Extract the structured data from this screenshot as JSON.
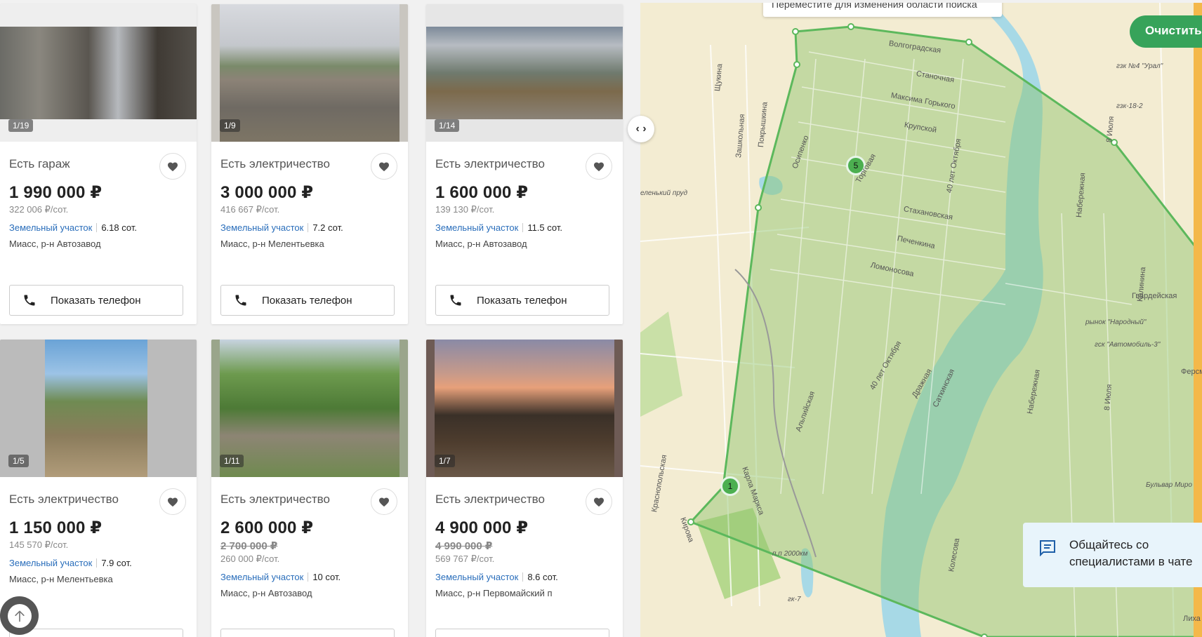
{
  "listings": [
    {
      "feature": "Есть гараж",
      "price": "1 990 000 ₽",
      "old_price": "",
      "per_sot": "322 006 ₽/сот.",
      "type": "Земельный участок",
      "area": "6.18 сот.",
      "address": "Миасс, р-н Автозавод",
      "photo_counter": "1/19",
      "phone_label": "Показать телефон"
    },
    {
      "feature": "Есть электричество",
      "price": "3 000 000 ₽",
      "old_price": "",
      "per_sot": "416 667 ₽/сот.",
      "type": "Земельный участок",
      "area": "7.2 сот.",
      "address": "Миасс, р-н Мелентьевка",
      "photo_counter": "1/9",
      "phone_label": "Показать телефон"
    },
    {
      "feature": "Есть электричество",
      "price": "1 600 000 ₽",
      "old_price": "",
      "per_sot": "139 130 ₽/сот.",
      "type": "Земельный участок",
      "area": "11.5 сот.",
      "address": "Миасс, р-н Автозавод",
      "photo_counter": "1/14",
      "phone_label": "Показать телефон"
    },
    {
      "feature": "Есть электричество",
      "price": "1 150 000 ₽",
      "old_price": "",
      "per_sot": "145 570 ₽/сот.",
      "type": "Земельный участок",
      "area": "7.9 сот.",
      "address": "Миасс, р-н Мелентьевка",
      "photo_counter": "1/5",
      "phone_label": ""
    },
    {
      "feature": "Есть электричество",
      "price": "2 600 000 ₽",
      "old_price": "2 700 000 ₽",
      "per_sot": "260 000 ₽/сот.",
      "type": "Земельный участок",
      "area": "10 сот.",
      "address": "Миасс, р-н Автозавод",
      "photo_counter": "1/11",
      "phone_label": ""
    },
    {
      "feature": "Есть электричество",
      "price": "4 900 000 ₽",
      "old_price": "4 990 000 ₽",
      "per_sot": "569 767 ₽/сот.",
      "type": "Земельный участок",
      "area": "8.6 сот.",
      "address": "Миасс, р-н Первомайский п",
      "photo_counter": "1/7",
      "phone_label": ""
    }
  ],
  "collapse_toggle": "‹ ›",
  "map": {
    "tooltip": "Переместите для изменения области поиска",
    "clear_button": "Очистить об",
    "chat_text": "Общайтесь со специалистами в чате",
    "clusters": [
      "5",
      "1"
    ],
    "streets": [
      "Волгоградская",
      "Станочная",
      "Максима Горького",
      "Крупской",
      "Торговая",
      "40 лет Октября",
      "Стахановская",
      "Печенкина",
      "Ломоносова",
      "Щукина",
      "Зашкольная",
      "Покрышкина",
      "Осипенко",
      "Набережная",
      "Калинина",
      "Гвардейская",
      "8 Июля",
      "40 лет Октября",
      "Дражная",
      "Саткинская",
      "Альпийская",
      "Карла Маркса",
      "Краснопольская",
      "Колесова",
      "Набережная",
      "8 Июля",
      "Ферсм",
      "Кирова",
      "Лиха"
    ],
    "pois": [
      "гзк №4 \"Урал\"",
      "гзк-18-2",
      "рынок \"Народный\"",
      "гск \"Автомобиль-3\"",
      "еленький пруд",
      "Бульвар Миро",
      "п.п 2000км",
      "гк-7"
    ]
  },
  "colors": {
    "accent_green": "#37a35a",
    "link_blue": "#2a6ebb",
    "polygon": "#5cb85c"
  },
  "icons": [
    "heart-icon",
    "phone-icon",
    "arrow-up-icon",
    "chat-icon"
  ]
}
